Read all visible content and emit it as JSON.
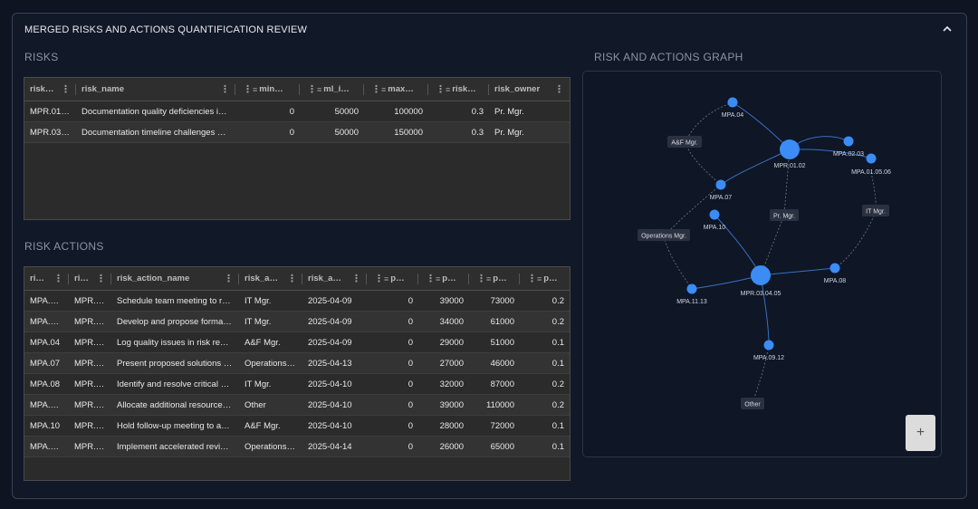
{
  "panel": {
    "title": "MERGED RISKS AND ACTIONS QUANTIFICATION REVIEW"
  },
  "risks": {
    "label": "RISKS",
    "columns": [
      "risk…",
      "risk_name",
      "min…",
      "ml_i…",
      "max…",
      "risk…",
      "risk_owner"
    ],
    "rows": [
      [
        "MPR.01…",
        "Documentation quality deficiencies i…",
        "0",
        "50000",
        "100000",
        "0.3",
        "Pr. Mgr."
      ],
      [
        "MPR.03…",
        "Documentation timeline challenges …",
        "0",
        "50000",
        "150000",
        "0.3",
        "Pr. Mgr."
      ]
    ]
  },
  "actions": {
    "label": "RISK ACTIONS",
    "columns": [
      "ri…",
      "ri…",
      "risk_action_name",
      "risk_a…",
      "risk_a…",
      "p…",
      "p…",
      "p…",
      "p…"
    ],
    "rows": [
      [
        "MPA.…",
        "MPR.…",
        "Schedule team meeting to r…",
        "IT Mgr.",
        "2025-04-09",
        "0",
        "39000",
        "73000",
        "0.2"
      ],
      [
        "MPA.…",
        "MPR.…",
        "Develop and propose forma…",
        "IT Mgr.",
        "2025-04-09",
        "0",
        "34000",
        "61000",
        "0.2"
      ],
      [
        "MPA.04",
        "MPR.…",
        "Log quality issues in risk re…",
        "A&F Mgr.",
        "2025-04-09",
        "0",
        "29000",
        "51000",
        "0.1"
      ],
      [
        "MPA.07",
        "MPR.…",
        "Present proposed solutions …",
        "Operations…",
        "2025-04-13",
        "0",
        "27000",
        "46000",
        "0.1"
      ],
      [
        "MPA.08",
        "MPR.…",
        "Identify and resolve critical …",
        "IT Mgr.",
        "2025-04-10",
        "0",
        "32000",
        "87000",
        "0.2"
      ],
      [
        "MPA.…",
        "MPR.…",
        "Allocate additional resource…",
        "Other",
        "2025-04-10",
        "0",
        "39000",
        "110000",
        "0.2"
      ],
      [
        "MPA.10",
        "MPR.…",
        "Hold follow-up meeting to a…",
        "A&F Mgr.",
        "2025-04-10",
        "0",
        "28000",
        "72000",
        "0.1"
      ],
      [
        "MPA.…",
        "MPR.…",
        "Implement accelerated revi…",
        "Operations…",
        "2025-04-14",
        "0",
        "26000",
        "65000",
        "0.1"
      ]
    ]
  },
  "graph": {
    "label": "RISK AND ACTIONS GRAPH",
    "node_color": "#3b8cf5",
    "edge_color": "#3a6fc0",
    "zoom_label": "+",
    "nodes": {
      "r1": "MPR.01.02",
      "r3": "MPR.03.04.05",
      "a04": "MPA.04",
      "a0203": "MPA.02.03",
      "a010506": "MPA.01.05.06",
      "a07": "MPA.07",
      "a10": "MPA.10",
      "a08": "MPA.08",
      "a1113": "MPA.11.13",
      "a0912": "MPA.09.12"
    },
    "owners": {
      "af": "A&F Mgr.",
      "pr": "Pr. Mgr.",
      "it": "IT Mgr.",
      "ops": "Operations Mgr.",
      "other": "Other"
    }
  }
}
